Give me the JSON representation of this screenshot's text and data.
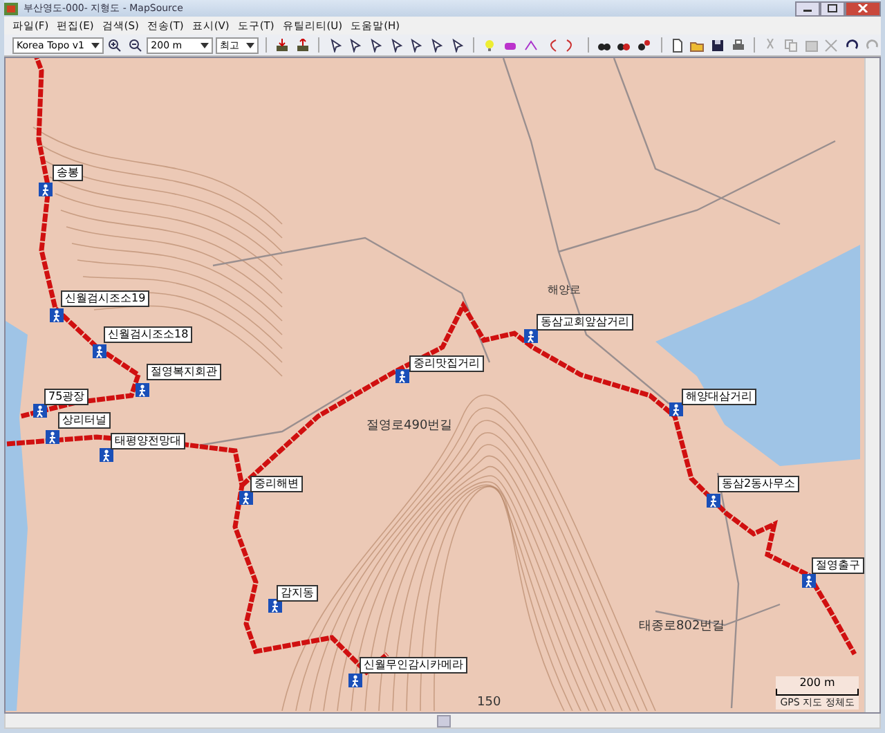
{
  "window": {
    "title": "부산영도-000- 지형도 - MapSource"
  },
  "menu": [
    "파일(F)",
    "편집(E)",
    "검색(S)",
    "전송(T)",
    "표시(V)",
    "도구(T)",
    "유틸리티(U)",
    "도움말(H)"
  ],
  "toolbar": {
    "map_product": "Korea Topo v1",
    "zoom_scale": "200 m",
    "detail": "최고"
  },
  "map": {
    "waypoints": [
      {
        "label": "송봉"
      },
      {
        "label": "신월검시조소19"
      },
      {
        "label": "동삼교회앞삼거리"
      },
      {
        "label": "신월검시조소18"
      },
      {
        "label": "중리맛집거리"
      },
      {
        "label": "절영복지회관"
      },
      {
        "label": "75광장"
      },
      {
        "label": "해양대삼거리"
      },
      {
        "label": "상리터널"
      },
      {
        "label": "태평양전망대"
      },
      {
        "label": "중리해변"
      },
      {
        "label": "동삼2동사무소"
      },
      {
        "label": "절영출구"
      },
      {
        "label": "감지동"
      },
      {
        "label": "신월무인감시카메라"
      }
    ],
    "labels": [
      "해양로",
      "절영로490번길",
      "태종로802번길",
      "150"
    ],
    "scale": "200 m",
    "footer": "GPS 지도 정체도"
  }
}
